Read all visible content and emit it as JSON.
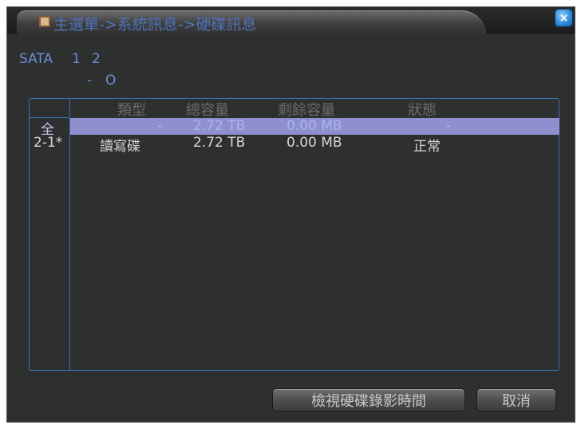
{
  "window": {
    "title": "主選單->系統訊息->硬碟訊息",
    "close_label": "×"
  },
  "sata": {
    "label": "SATA",
    "ports": [
      "1",
      "2"
    ],
    "port_status": [
      "-",
      "O"
    ]
  },
  "table": {
    "columns": [
      "類型",
      "總容量",
      "剩餘容量",
      "狀態"
    ],
    "rows": [
      {
        "id": "全",
        "type": "-",
        "total": "2.72 TB",
        "free": "0.00 MB",
        "status": "-",
        "selected": true
      },
      {
        "id": "2-1*",
        "type": "讀寫碟",
        "total": "2.72 TB",
        "free": "0.00 MB",
        "status": "正常",
        "selected": false
      }
    ]
  },
  "buttons": {
    "view_record_time": "檢視硬碟錄影時間",
    "cancel": "取消"
  },
  "colors": {
    "panel_bg": "#2e2f2f",
    "accent_blue": "#3f6fb8",
    "title_text": "#4f72b8",
    "selection": "#8f8fcf"
  }
}
